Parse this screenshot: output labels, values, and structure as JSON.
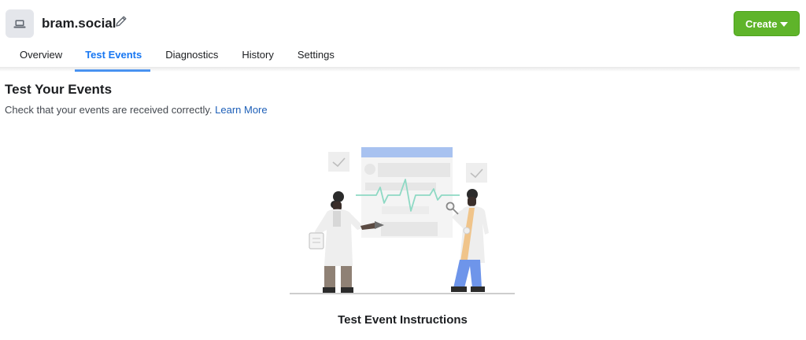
{
  "header": {
    "pixel_name": "bram.social",
    "pixel_icon": "laptop-icon",
    "edit_icon": "pencil-icon",
    "create_label": "Create"
  },
  "tabs": [
    {
      "label": "Overview",
      "active": false
    },
    {
      "label": "Test Events",
      "active": true
    },
    {
      "label": "Diagnostics",
      "active": false
    },
    {
      "label": "History",
      "active": false
    },
    {
      "label": "Settings",
      "active": false
    }
  ],
  "main": {
    "title": "Test Your Events",
    "description": "Check that your events are received correctly.",
    "learn_more": "Learn More",
    "instructions_title": "Test Event Instructions"
  },
  "colors": {
    "accent": "#1877f2",
    "create_button": "#5fb42a",
    "link": "#1d5fb8"
  }
}
